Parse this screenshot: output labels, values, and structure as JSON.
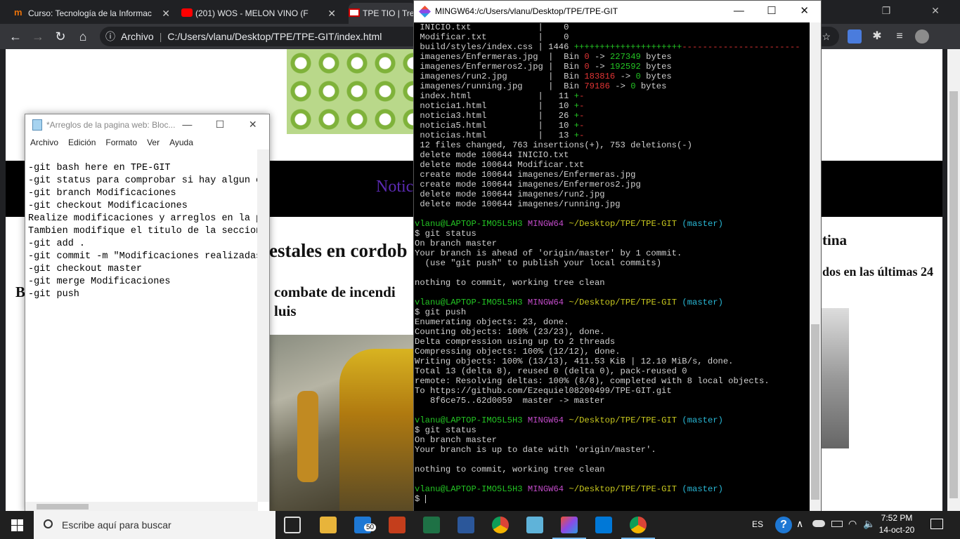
{
  "chrome": {
    "tabs": [
      {
        "label": "Curso: Tecnología de la Informac",
        "fav_color": "#e8710a"
      },
      {
        "label": "(201) WOS - MELON VINO (F",
        "fav_color": "#ff0000"
      },
      {
        "label": "TPE TIO | Tre",
        "fav_color": "#ffffff"
      }
    ],
    "omnibox_label": "Archivo",
    "omnibox_url": "C:/Users/vlanu/Desktop/TPE/TPE-GIT/index.html"
  },
  "webpage": {
    "nav_text": "Notic",
    "headline_1": "estales en cordob",
    "headline_2": "combate de incendi",
    "headline_3": "luis",
    "headline_left": "B",
    "headline_right_1": "tina",
    "headline_right_2": "dos en las últimas 24"
  },
  "notepad": {
    "title": "*Arreglos de la pagina web: Bloc...",
    "menu": [
      "Archivo",
      "Edición",
      "Formato",
      "Ver",
      "Ayuda"
    ],
    "lines": [
      "-git bash here en TPE-GIT",
      "-git status para comprobar si hay algun e",
      "-git branch Modificaciones",
      "-git checkout Modificaciones",
      "Realize modificaciones y arreglos en la p",
      "Tambien modifique el titulo de la seccion",
      "-git add .",
      "-git commit -m \"Modificaciones realizadas",
      "-git checkout master",
      "-git merge Modificaciones",
      "-git push"
    ]
  },
  "gitbash": {
    "title": "MINGW64:/c/Users/vlanu/Desktop/TPE/TPE-GIT",
    "prompt_user": "vlanu@LAPTOP-IMO5L5H3",
    "prompt_sys": "MINGW64",
    "prompt_path": "~/Desktop/TPE/TPE-GIT",
    "prompt_branch": "(master)"
  },
  "taskbar": {
    "search_placeholder": "Escribe aquí para buscar",
    "language": "ES",
    "time": "7:52 PM",
    "date": "14-oct-20",
    "mail_badge": "50"
  }
}
